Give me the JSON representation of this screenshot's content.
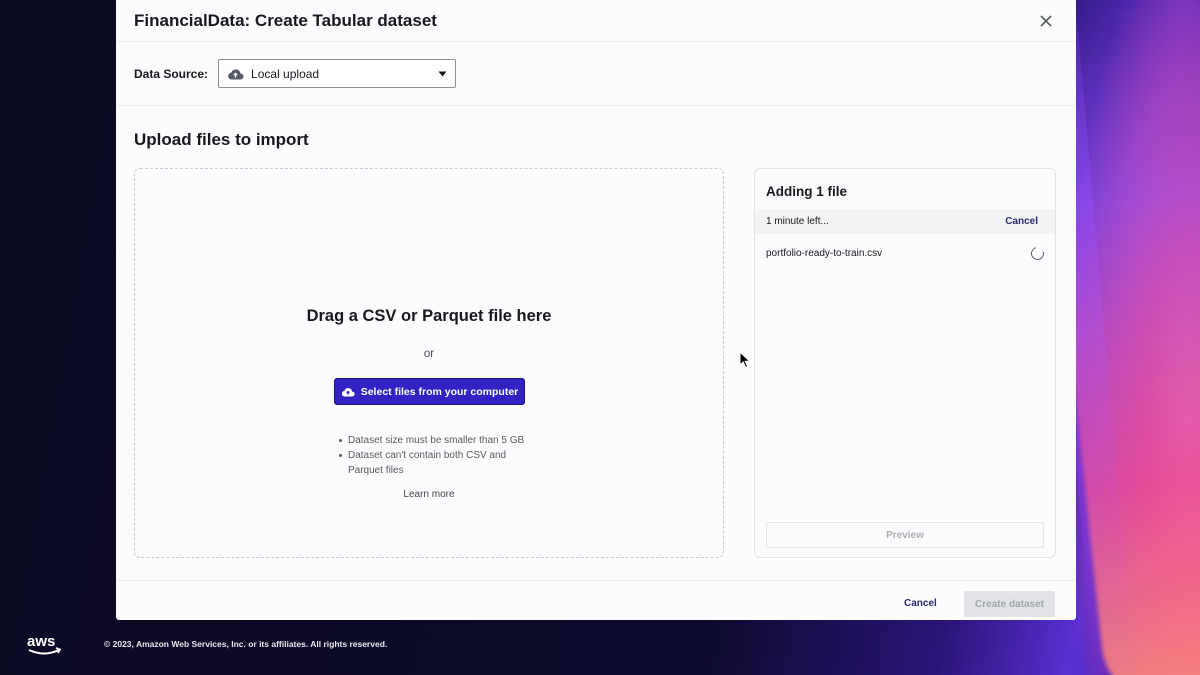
{
  "modal": {
    "title": "FinancialData: Create Tabular dataset",
    "data_source": {
      "label": "Data Source:",
      "selected": "Local upload",
      "icon": "cloud-upload-icon"
    },
    "section_title": "Upload files to import"
  },
  "dropzone": {
    "title": "Drag a CSV or Parquet file here",
    "or": "or",
    "button_label": "Select files from your computer",
    "button_icon": "cloud-upload-icon",
    "notes": [
      "Dataset size must be smaller than 5 GB",
      "Dataset can't contain both CSV and Parquet files"
    ],
    "learn_more": "Learn more"
  },
  "upload_panel": {
    "title": "Adding 1 file",
    "status": "1 minute left...",
    "cancel": "Cancel",
    "file_name": "portfolio-ready-to-train.csv",
    "preview": "Preview"
  },
  "footer": {
    "cancel": "Cancel",
    "create": "Create dataset"
  },
  "page_footer": {
    "logo": "aws",
    "copyright": "© 2023, Amazon Web Services, Inc. or its affiliates. All rights reserved."
  },
  "colors": {
    "primary_button": "#3322c4",
    "link_text": "#2c2a6b",
    "disabled_text": "#a0a6ae"
  }
}
